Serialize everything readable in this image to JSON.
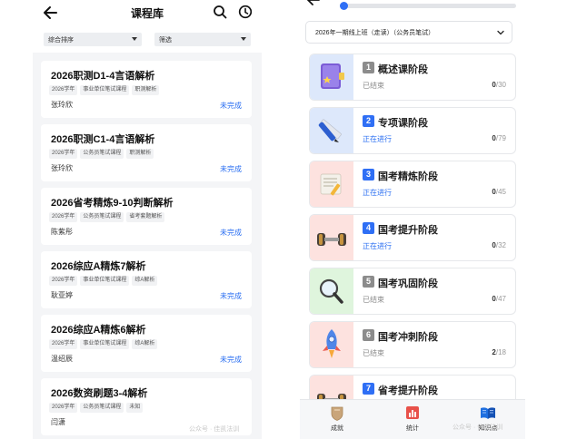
{
  "left": {
    "title": "课程库",
    "sort_label": "综合排序",
    "filter_label": "筛选",
    "courses": [
      {
        "title": "2026职测D1-4言语解析",
        "tags": [
          "2026学年",
          "事业单位笔试课程",
          "职测解析"
        ],
        "author": "张玲欣",
        "status": "未完成"
      },
      {
        "title": "2026职测C1-4言语解析",
        "tags": [
          "2026学年",
          "公务员笔试课程",
          "职测解析"
        ],
        "author": "张玲欣",
        "status": "未完成"
      },
      {
        "title": "2026省考精炼9-10判断解析",
        "tags": [
          "2026学年",
          "公务员笔试课程",
          "省考套题解析"
        ],
        "author": "陈紫彤",
        "status": "未完成"
      },
      {
        "title": "2026综应A精炼7解析",
        "tags": [
          "2026学年",
          "事业单位笔试课程",
          "综A解析"
        ],
        "author": "耿亚婷",
        "status": "未完成"
      },
      {
        "title": "2026综应A精炼6解析",
        "tags": [
          "2026学年",
          "事业单位笔试课程",
          "综A解析"
        ],
        "author": "温绍辰",
        "status": "未完成"
      },
      {
        "title": "2026数资刷题3-4解析",
        "tags": [
          "2026学年",
          "公务员笔试课程",
          "未知"
        ],
        "author": "闫潇",
        "status": ""
      }
    ],
    "watermark": "公众号 · 佳凯法训"
  },
  "right": {
    "course_select": "2026年一期线上班（走读）（公务员笔试）",
    "stages": [
      {
        "num": "1",
        "name": "概述课阶段",
        "state": "已结束",
        "done": "0",
        "total": "/30",
        "thumb": "book-icon"
      },
      {
        "num": "2",
        "name": "专项课阶段",
        "state": "正在进行",
        "done": "0",
        "total": "/79",
        "thumb": "pen-ruler-icon"
      },
      {
        "num": "3",
        "name": "国考精炼阶段",
        "state": "正在进行",
        "done": "0",
        "total": "/45",
        "thumb": "scroll-icon"
      },
      {
        "num": "4",
        "name": "国考提升阶段",
        "state": "正在进行",
        "done": "0",
        "total": "/32",
        "thumb": "dumbbell-icon"
      },
      {
        "num": "5",
        "name": "国考巩固阶段",
        "state": "已结束",
        "done": "0",
        "total": "/47",
        "thumb": "magnifier-icon"
      },
      {
        "num": "6",
        "name": "国考冲刺阶段",
        "state": "已结束",
        "done": "2",
        "total": "/18",
        "thumb": "rocket-icon"
      },
      {
        "num": "7",
        "name": "省考提升阶段",
        "state": "",
        "done": "",
        "total": "",
        "thumb": "dumbbell-icon"
      }
    ],
    "tabs": [
      {
        "label": "成就",
        "icon": "shield-icon"
      },
      {
        "label": "统计",
        "icon": "bar-chart-icon"
      },
      {
        "label": "知识点",
        "icon": "open-book-icon"
      }
    ],
    "watermark": "公众号 · 佳凯法训"
  },
  "colors": {
    "accent": "#2b6ff2",
    "ended": "#8a8a8a",
    "ongoing": "#2b6ff2",
    "badge_ended": "#8c8c8c",
    "badge_active": "#2f6ff5"
  }
}
